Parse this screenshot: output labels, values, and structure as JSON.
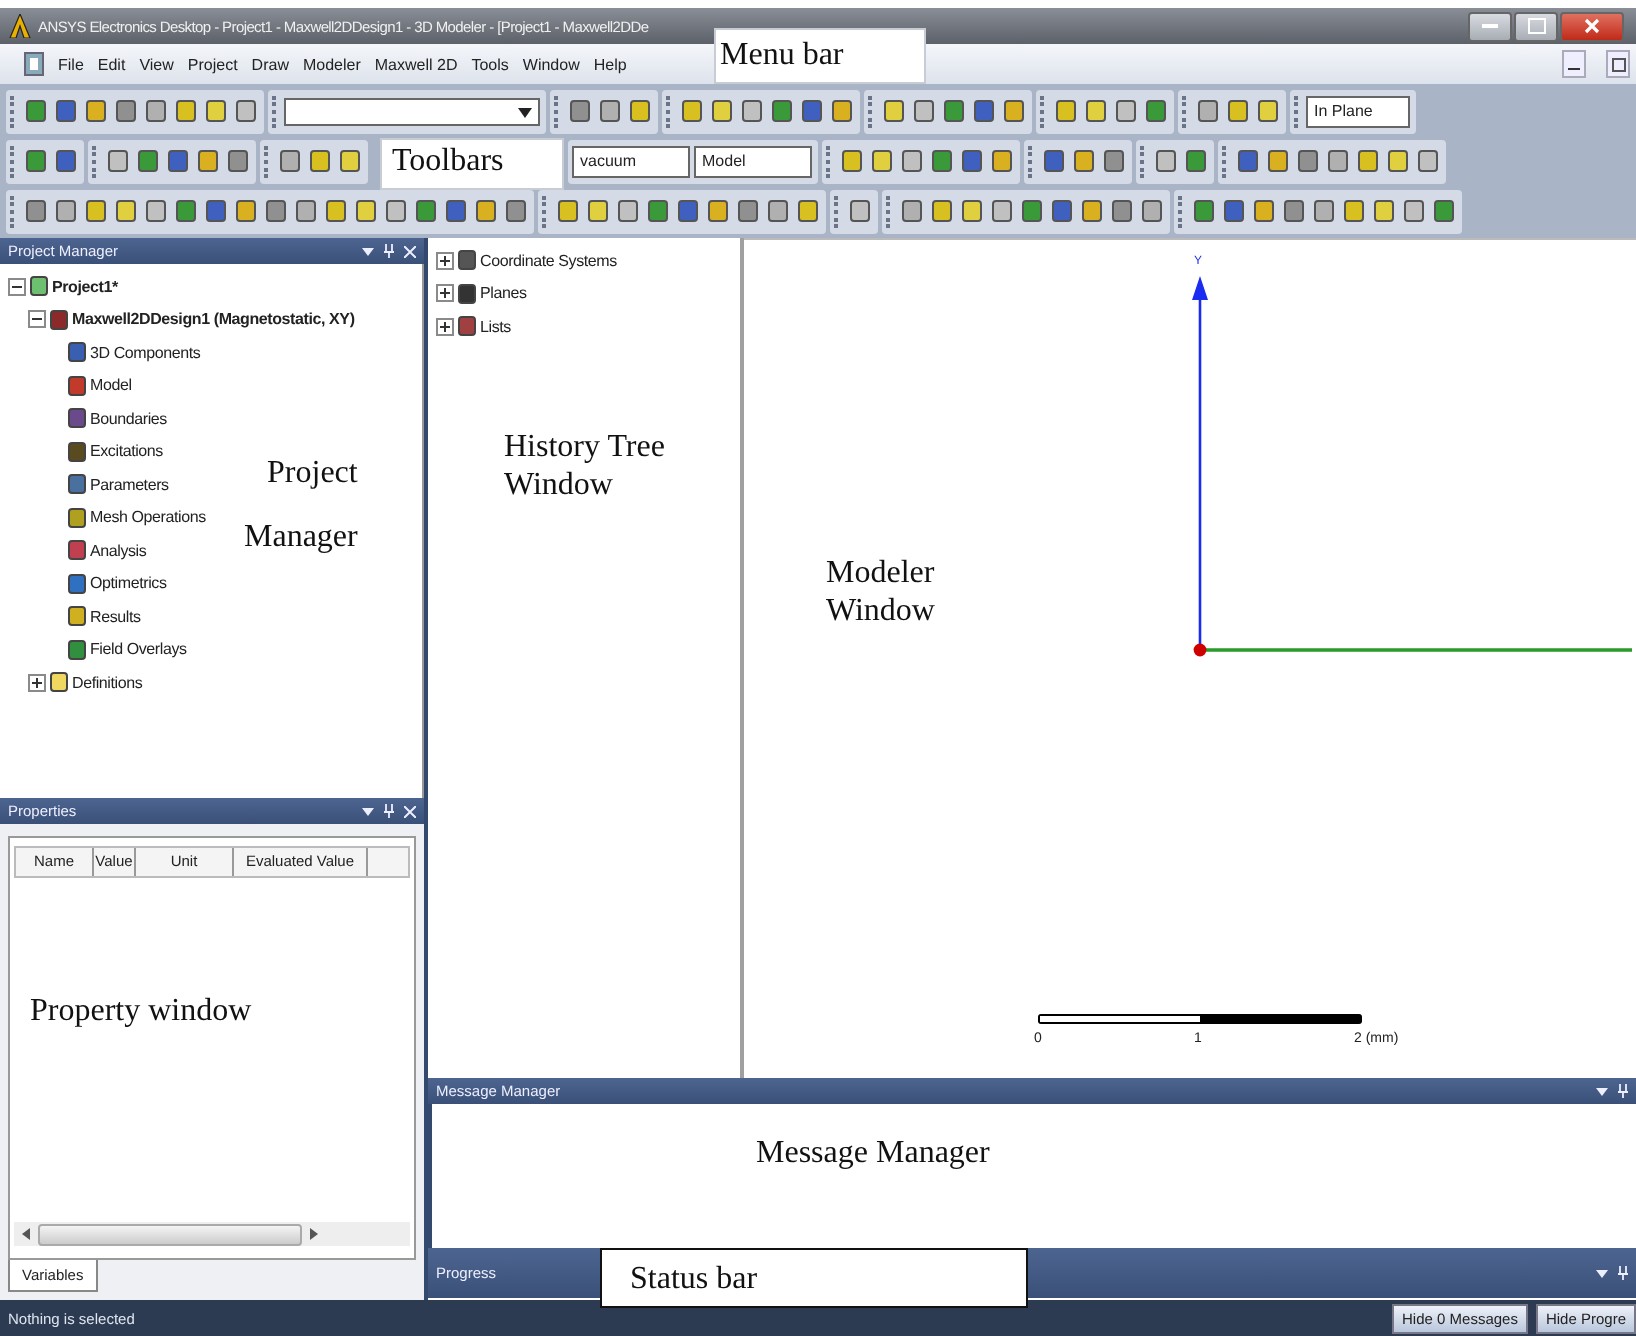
{
  "window": {
    "title": "ANSYS Electronics Desktop - Project1 - Maxwell2DDesign1 - 3D Modeler - [Project1 - Maxwell2DDe"
  },
  "menu_bar": {
    "items": [
      "File",
      "Edit",
      "View",
      "Project",
      "Draw",
      "Modeler",
      "Maxwell 2D",
      "Tools",
      "Window",
      "Help"
    ],
    "annotation": "Menu bar"
  },
  "toolbars": {
    "annotation": "Toolbars",
    "plane_combo": "In Plane",
    "material_combo": "vacuum",
    "model_combo": "Model"
  },
  "project_manager": {
    "title": "Project Manager",
    "annotation_lines": [
      "Project",
      "Manager"
    ],
    "tree": [
      {
        "label": "Project1*",
        "expanded": true,
        "children": [
          {
            "label": "Maxwell2DDesign1 (Magnetostatic, XY)",
            "expanded": true,
            "children": [
              {
                "label": "3D Components"
              },
              {
                "label": "Model"
              },
              {
                "label": "Boundaries"
              },
              {
                "label": "Excitations"
              },
              {
                "label": "Parameters"
              },
              {
                "label": "Mesh Operations"
              },
              {
                "label": "Analysis"
              },
              {
                "label": "Optimetrics"
              },
              {
                "label": "Results"
              },
              {
                "label": "Field Overlays"
              }
            ]
          },
          {
            "label": "Definitions",
            "expanded": false
          }
        ]
      }
    ]
  },
  "history_tree": {
    "annotation_lines": [
      "History Tree",
      "Window"
    ],
    "items": [
      {
        "label": "Coordinate Systems",
        "expanded": false
      },
      {
        "label": "Planes",
        "expanded": false
      },
      {
        "label": "Lists",
        "expanded": false
      }
    ]
  },
  "modeler": {
    "annotation_lines": [
      "Modeler",
      "Window"
    ],
    "axis_label": "Y",
    "scale_labels": [
      "0",
      "1",
      "2 (mm)"
    ]
  },
  "properties": {
    "title": "Properties",
    "columns": [
      "Name",
      "Value",
      "Unit",
      "Evaluated Value"
    ],
    "annotation": "Property window",
    "tabs": [
      {
        "label": "Variables",
        "selected": true
      }
    ]
  },
  "message_manager": {
    "title": "Message Manager",
    "annotation": "Message Manager"
  },
  "progress": {
    "title": "Progress",
    "annotation": "Status bar"
  },
  "status_bar": {
    "text": "Nothing is selected",
    "buttons": [
      "Hide 0 Messages",
      "Hide Progre"
    ]
  }
}
